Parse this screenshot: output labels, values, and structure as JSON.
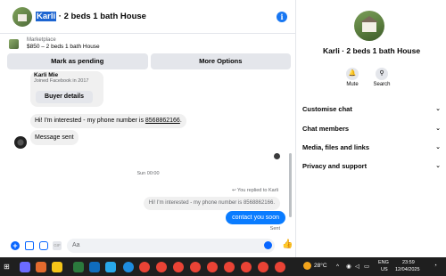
{
  "chat": {
    "header": {
      "name_highlight": "Karli",
      "title_rest": " · 2 beds 1 bath House"
    },
    "listing": {
      "category": "Marketplace",
      "summary": "$850 – 2 beds 1 bath House"
    },
    "actions": {
      "mark_pending": "Mark as pending",
      "more_options": "More Options"
    },
    "intro": {
      "name": "Karli Mie",
      "joined": "Joined Facebook in 2017",
      "buyer_details": "Buyer details"
    },
    "messages": {
      "phone_prefix": "Hi! I'm interested - my phone number is ",
      "phone_number": "8568862166",
      "phone_suffix": ".",
      "message_sent": "Message sent",
      "timestamp": "Sun 00:00",
      "replied_to": "You replied to Karli",
      "quoted": "Hi! I'm interested - my phone number is 8568862166.",
      "my_message": "contact you soon",
      "status": "Sent"
    },
    "composer": {
      "placeholder": "Aa",
      "gif_label": "GIF"
    }
  },
  "panel": {
    "title": "Karli · 2 beds 1 bath House",
    "buttons": [
      {
        "label": "Mute",
        "icon": "bell-icon"
      },
      {
        "label": "Search",
        "icon": "search-icon"
      }
    ],
    "sections": [
      {
        "label": "Customise chat"
      },
      {
        "label": "Chat members"
      },
      {
        "label": "Media, files and links"
      },
      {
        "label": "Privacy and support"
      }
    ]
  },
  "taskbar": {
    "weather": "28°C",
    "language": "ENG",
    "region": "US",
    "time": "23:59",
    "date": "12/04/2025"
  },
  "colors": {
    "accent": "#0866ff",
    "my_bubble": "#0a7cff",
    "bubble_in": "#f0f0f0",
    "taskbar": "#1f1f1f"
  }
}
